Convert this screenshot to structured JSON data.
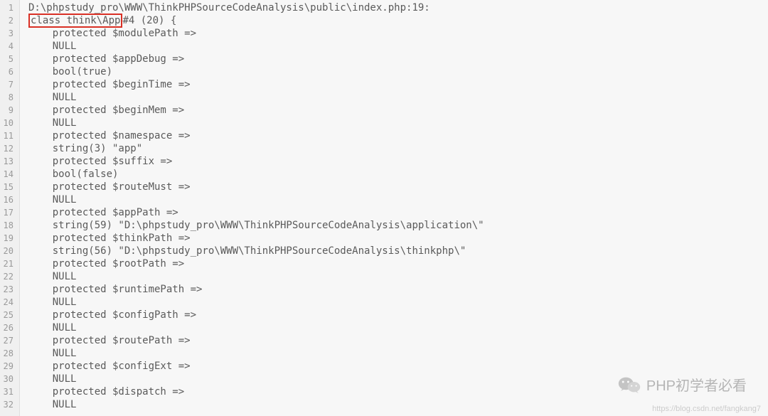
{
  "code": {
    "lines": [
      {
        "num": 1,
        "indent": 0,
        "text": "D:\\phpstudy_pro\\WWW\\ThinkPHPSourceCodeAnalysis\\public\\index.php:19:",
        "highlight": null
      },
      {
        "num": 2,
        "indent": 0,
        "text": "class think\\App#4 (20) {",
        "highlight": "class think\\App"
      },
      {
        "num": 3,
        "indent": 1,
        "text": "protected $modulePath =>",
        "highlight": null
      },
      {
        "num": 4,
        "indent": 1,
        "text": "NULL",
        "highlight": null
      },
      {
        "num": 5,
        "indent": 1,
        "text": "protected $appDebug =>",
        "highlight": null
      },
      {
        "num": 6,
        "indent": 1,
        "text": "bool(true)",
        "highlight": null
      },
      {
        "num": 7,
        "indent": 1,
        "text": "protected $beginTime =>",
        "highlight": null
      },
      {
        "num": 8,
        "indent": 1,
        "text": "NULL",
        "highlight": null
      },
      {
        "num": 9,
        "indent": 1,
        "text": "protected $beginMem =>",
        "highlight": null
      },
      {
        "num": 10,
        "indent": 1,
        "text": "NULL",
        "highlight": null
      },
      {
        "num": 11,
        "indent": 1,
        "text": "protected $namespace =>",
        "highlight": null
      },
      {
        "num": 12,
        "indent": 1,
        "text": "string(3) \"app\"",
        "highlight": null
      },
      {
        "num": 13,
        "indent": 1,
        "text": "protected $suffix =>",
        "highlight": null
      },
      {
        "num": 14,
        "indent": 1,
        "text": "bool(false)",
        "highlight": null
      },
      {
        "num": 15,
        "indent": 1,
        "text": "protected $routeMust =>",
        "highlight": null
      },
      {
        "num": 16,
        "indent": 1,
        "text": "NULL",
        "highlight": null
      },
      {
        "num": 17,
        "indent": 1,
        "text": "protected $appPath =>",
        "highlight": null
      },
      {
        "num": 18,
        "indent": 1,
        "text": "string(59) \"D:\\phpstudy_pro\\WWW\\ThinkPHPSourceCodeAnalysis\\application\\\"",
        "highlight": null
      },
      {
        "num": 19,
        "indent": 1,
        "text": "protected $thinkPath =>",
        "highlight": null
      },
      {
        "num": 20,
        "indent": 1,
        "text": "string(56) \"D:\\phpstudy_pro\\WWW\\ThinkPHPSourceCodeAnalysis\\thinkphp\\\"",
        "highlight": null
      },
      {
        "num": 21,
        "indent": 1,
        "text": "protected $rootPath =>",
        "highlight": null
      },
      {
        "num": 22,
        "indent": 1,
        "text": "NULL",
        "highlight": null
      },
      {
        "num": 23,
        "indent": 1,
        "text": "protected $runtimePath =>",
        "highlight": null
      },
      {
        "num": 24,
        "indent": 1,
        "text": "NULL",
        "highlight": null
      },
      {
        "num": 25,
        "indent": 1,
        "text": "protected $configPath =>",
        "highlight": null
      },
      {
        "num": 26,
        "indent": 1,
        "text": "NULL",
        "highlight": null
      },
      {
        "num": 27,
        "indent": 1,
        "text": "protected $routePath =>",
        "highlight": null
      },
      {
        "num": 28,
        "indent": 1,
        "text": "NULL",
        "highlight": null
      },
      {
        "num": 29,
        "indent": 1,
        "text": "protected $configExt =>",
        "highlight": null
      },
      {
        "num": 30,
        "indent": 1,
        "text": "NULL",
        "highlight": null
      },
      {
        "num": 31,
        "indent": 1,
        "text": "protected $dispatch =>",
        "highlight": null
      },
      {
        "num": 32,
        "indent": 1,
        "text": "NULL",
        "highlight": null
      }
    ]
  },
  "watermark": {
    "text": "PHP初学者必看",
    "url": "https://blog.csdn.net/fangkang7"
  }
}
